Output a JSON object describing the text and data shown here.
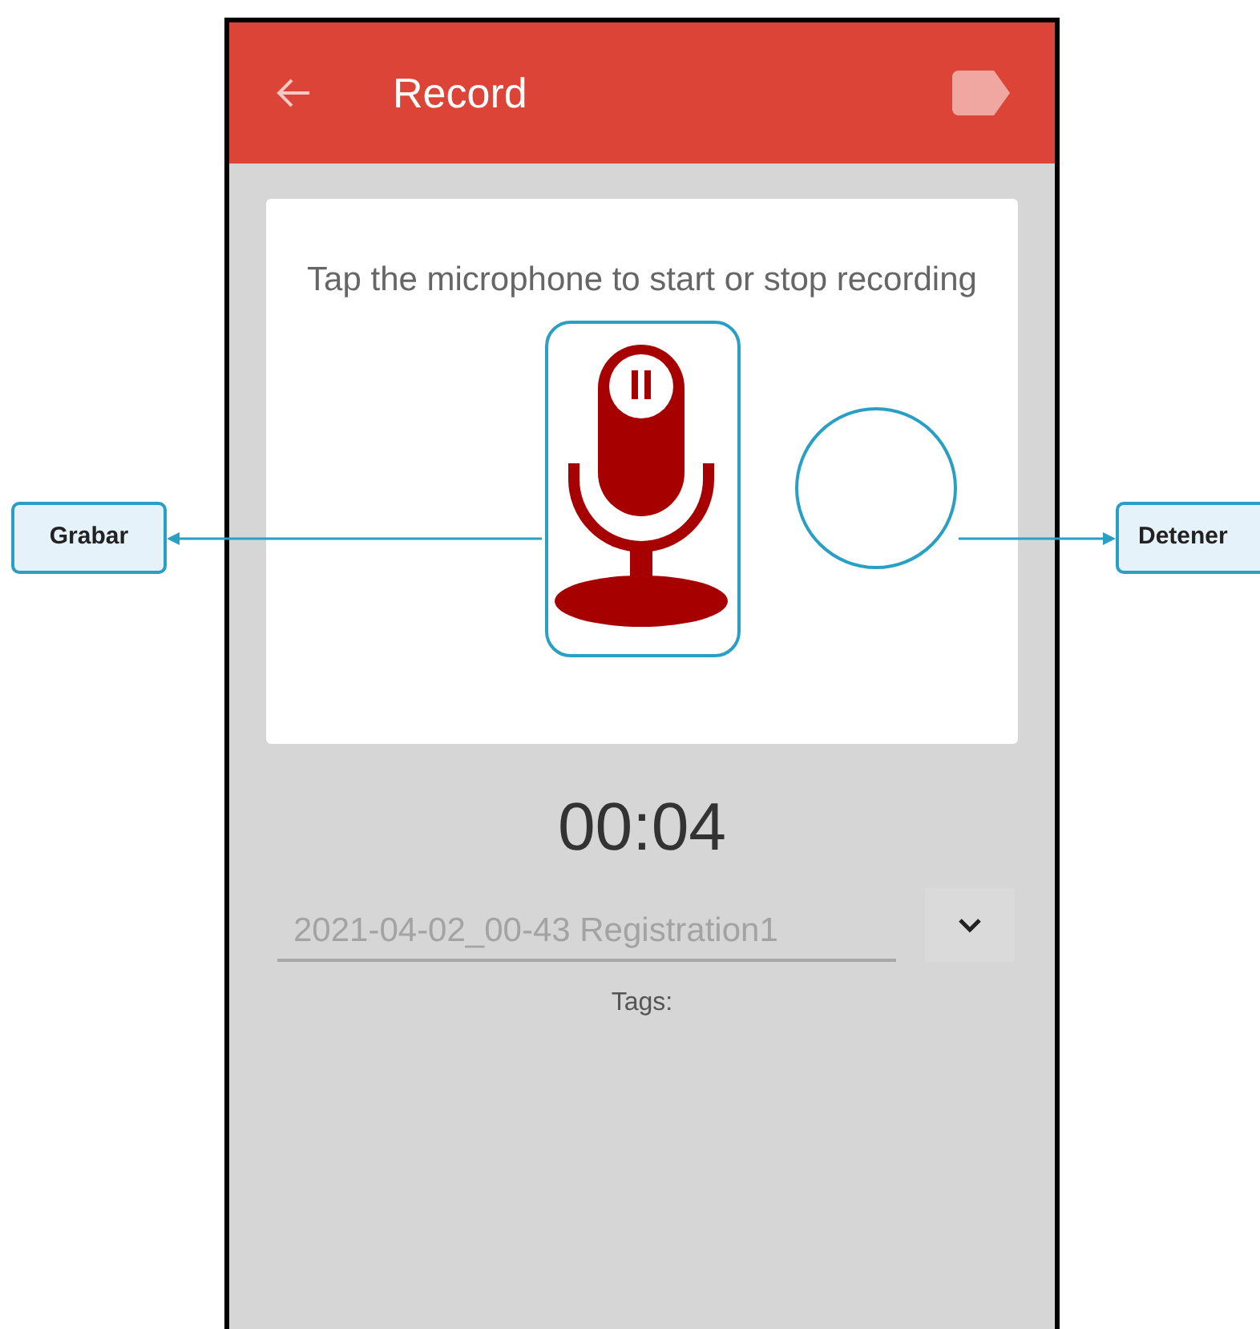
{
  "app_bar": {
    "title": "Record"
  },
  "card": {
    "instruction": "Tap the microphone to start or stop recording"
  },
  "timer": "00:04",
  "file_name": {
    "value": "2021-04-02_00-43 Registration1"
  },
  "tags_label": "Tags:",
  "callouts": [
    {
      "label": "Grabar"
    },
    {
      "label": "Detener"
    }
  ]
}
